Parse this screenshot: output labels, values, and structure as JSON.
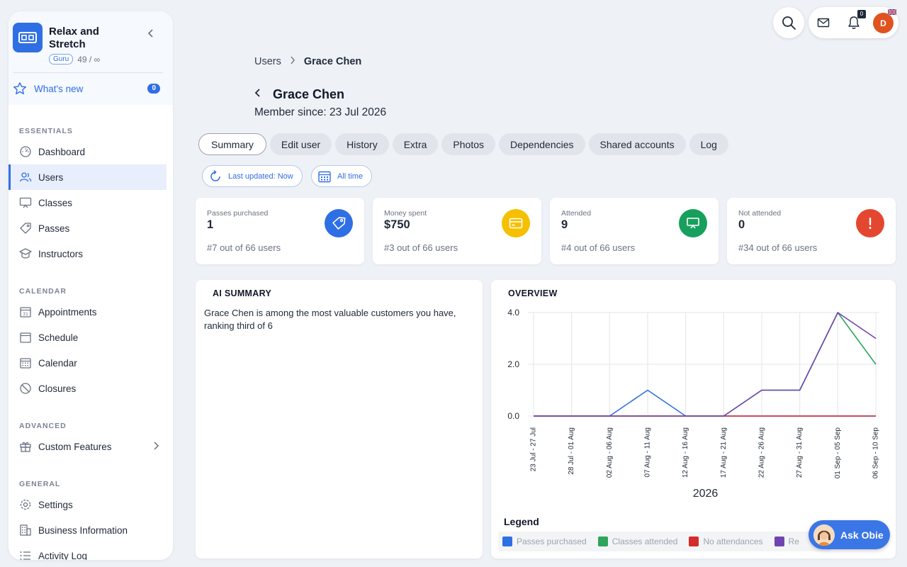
{
  "brand": {
    "name": "Relax and Stretch",
    "plan_badge": "Guru",
    "usage": "49 / ∞"
  },
  "whats_new": {
    "label": "What's new",
    "count": "0"
  },
  "sidebar": {
    "sections": [
      {
        "title": "ESSENTIALS",
        "items": [
          {
            "label": "Dashboard",
            "icon": "dashboard-icon"
          },
          {
            "label": "Users",
            "icon": "users-icon",
            "active": true
          },
          {
            "label": "Classes",
            "icon": "classes-icon"
          },
          {
            "label": "Passes",
            "icon": "tag-icon"
          },
          {
            "label": "Instructors",
            "icon": "instructor-icon"
          }
        ]
      },
      {
        "title": "CALENDAR",
        "items": [
          {
            "label": "Appointments",
            "icon": "calendar-31-icon"
          },
          {
            "label": "Schedule",
            "icon": "calendar-icon"
          },
          {
            "label": "Calendar",
            "icon": "calendar-grid-icon"
          },
          {
            "label": "Closures",
            "icon": "ban-icon"
          }
        ]
      },
      {
        "title": "ADVANCED",
        "items": [
          {
            "label": "Custom Features",
            "icon": "gift-icon"
          }
        ]
      },
      {
        "title": "GENERAL",
        "items": [
          {
            "label": "Settings",
            "icon": "gear-icon"
          },
          {
            "label": "Business Information",
            "icon": "building-icon"
          },
          {
            "label": "Activity Log",
            "icon": "list-icon"
          }
        ]
      }
    ]
  },
  "topbar": {
    "notifications_count": "0",
    "avatar_initial": "D"
  },
  "breadcrumb": {
    "parent": "Users",
    "current": "Grace Chen"
  },
  "header": {
    "title": "Grace Chen",
    "subtitle": "Member since: 23 Jul 2026"
  },
  "tabs": [
    "Summary",
    "Edit user",
    "History",
    "Extra",
    "Photos",
    "Dependencies",
    "Shared accounts",
    "Log"
  ],
  "active_tab": "Summary",
  "filters": {
    "last_updated": "Last updated: Now",
    "range": "All time"
  },
  "stats": [
    {
      "label": "Passes purchased",
      "value": "1",
      "rank": "#7 out of 66 users",
      "color": "#2f6fe4",
      "icon": "tag-icon"
    },
    {
      "label": "Money spent",
      "value": "$750",
      "rank": "#3 out of 66 users",
      "color": "#f5c000",
      "icon": "card-icon"
    },
    {
      "label": "Attended",
      "value": "9",
      "rank": "#4 out of 66 users",
      "color": "#17a05d",
      "icon": "presentation-icon"
    },
    {
      "label": "Not attended",
      "value": "0",
      "rank": "#34 out of 66 users",
      "color": "#e4472f",
      "icon": "exclamation-icon"
    }
  ],
  "ai_summary": {
    "title": "AI SUMMARY",
    "text": "Grace Chen is among the most valuable customers you have, ranking third of 6"
  },
  "overview": {
    "title": "OVERVIEW",
    "legend_title": "Legend"
  },
  "chart_data": {
    "type": "line",
    "title": "OVERVIEW",
    "xlabel": "2026",
    "ylabel": "",
    "categories": [
      "23 Jul - 27 Jul",
      "28 Jul - 01 Aug",
      "02 Aug - 06 Aug",
      "07 Aug - 11 Aug",
      "12 Aug - 16 Aug",
      "17 Aug - 21 Aug",
      "22 Aug - 26 Aug",
      "27 Aug - 31 Aug",
      "01 Sep - 05 Sep",
      "06 Sep - 10 Sep"
    ],
    "ylim": [
      0,
      4
    ],
    "yticks": [
      "0.0",
      "2.0",
      "4.0"
    ],
    "grid": true,
    "legend_position": "bottom",
    "series": [
      {
        "name": "Passes purchased",
        "color": "#2f6fe4",
        "values": [
          0,
          0,
          0,
          1,
          0,
          0,
          0,
          0,
          0,
          0
        ]
      },
      {
        "name": "Classes attended",
        "color": "#2ea55a",
        "values": [
          0,
          0,
          0,
          0,
          0,
          0,
          1,
          1,
          4,
          2
        ]
      },
      {
        "name": "No attendances",
        "color": "#d62b2b",
        "values": [
          0,
          0,
          0,
          0,
          0,
          0,
          0,
          0,
          0,
          0
        ]
      },
      {
        "name": "Re",
        "color": "#7044b0",
        "values": [
          0,
          0,
          0,
          0,
          0,
          0,
          1,
          1,
          4,
          3
        ]
      }
    ]
  },
  "ask_obie": {
    "label": "Ask Obie"
  }
}
